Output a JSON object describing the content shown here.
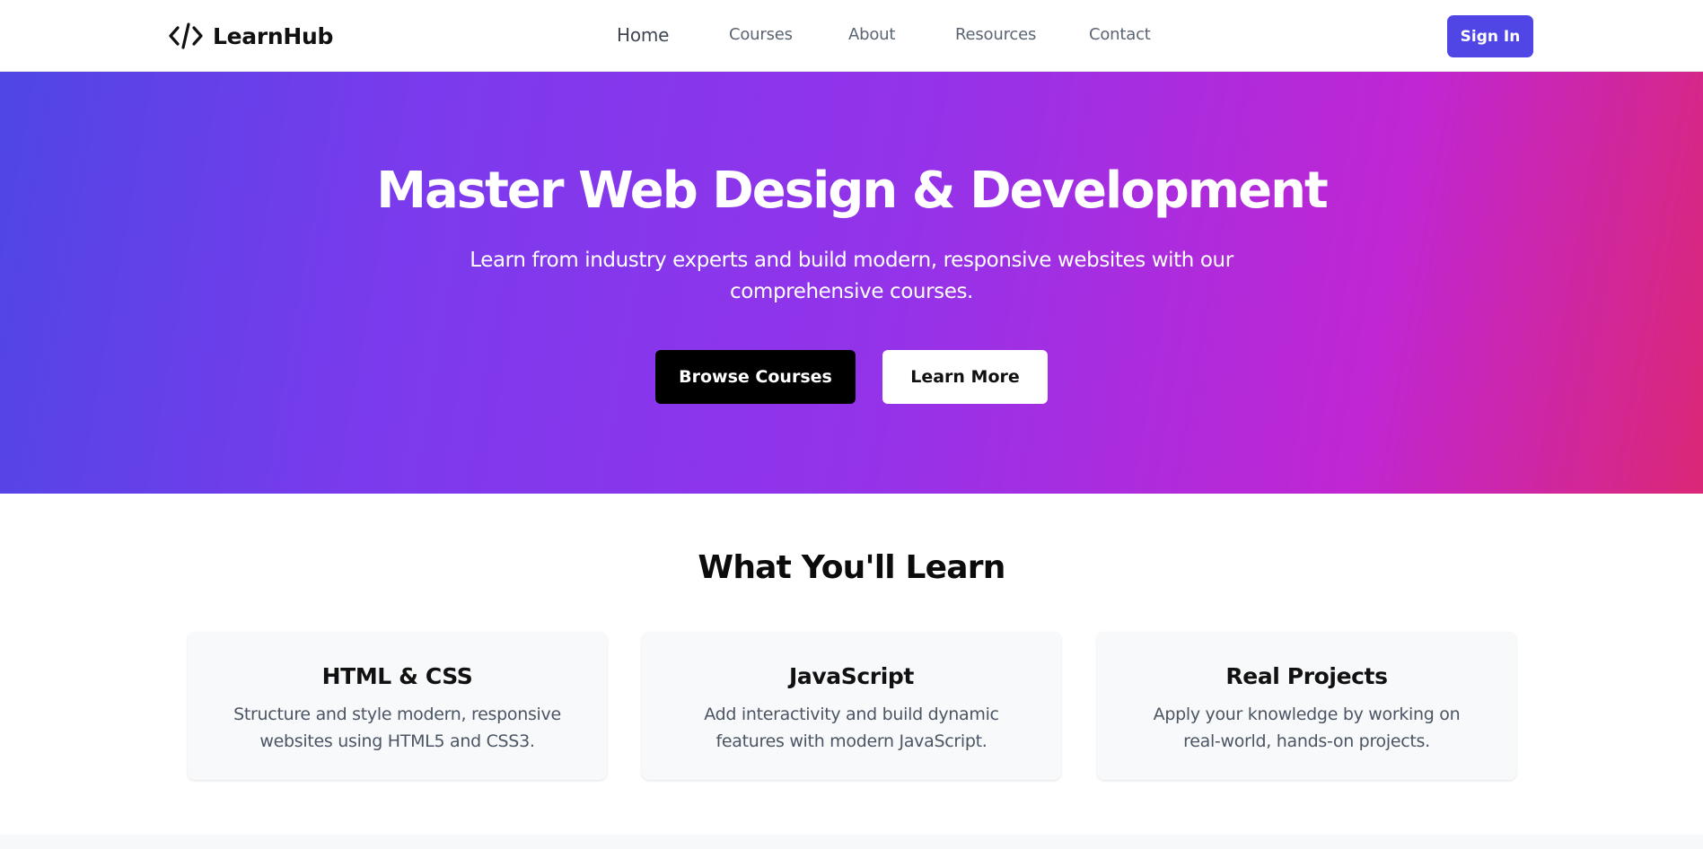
{
  "brand": {
    "name": "LearnHub",
    "icon": "code-brackets-icon"
  },
  "nav": {
    "links": [
      "Home",
      "Courses",
      "About",
      "Resources",
      "Contact"
    ],
    "active": "Home",
    "sign_in": "Sign In"
  },
  "hero": {
    "title": "Master Web Design & Development",
    "subtitle": "Learn from industry experts and build modern, responsive websites with our comprehensive courses.",
    "primary_button": "Browse Courses",
    "secondary_button": "Learn More"
  },
  "features": {
    "title": "What You'll Learn",
    "cards": [
      {
        "title": "HTML & CSS",
        "description": "Structure and style modern, responsive websites using HTML5 and CSS3."
      },
      {
        "title": "JavaScript",
        "description": "Add interactivity and build dynamic features with modern JavaScript."
      },
      {
        "title": "Real Projects",
        "description": "Apply your knowledge by working on real-world, hands-on projects."
      }
    ]
  },
  "colors": {
    "accent": "#4f46e5",
    "hero_gradient": [
      "#4f46e5",
      "#9333ea",
      "#db2777"
    ],
    "card_background": "#f8f9fb"
  }
}
